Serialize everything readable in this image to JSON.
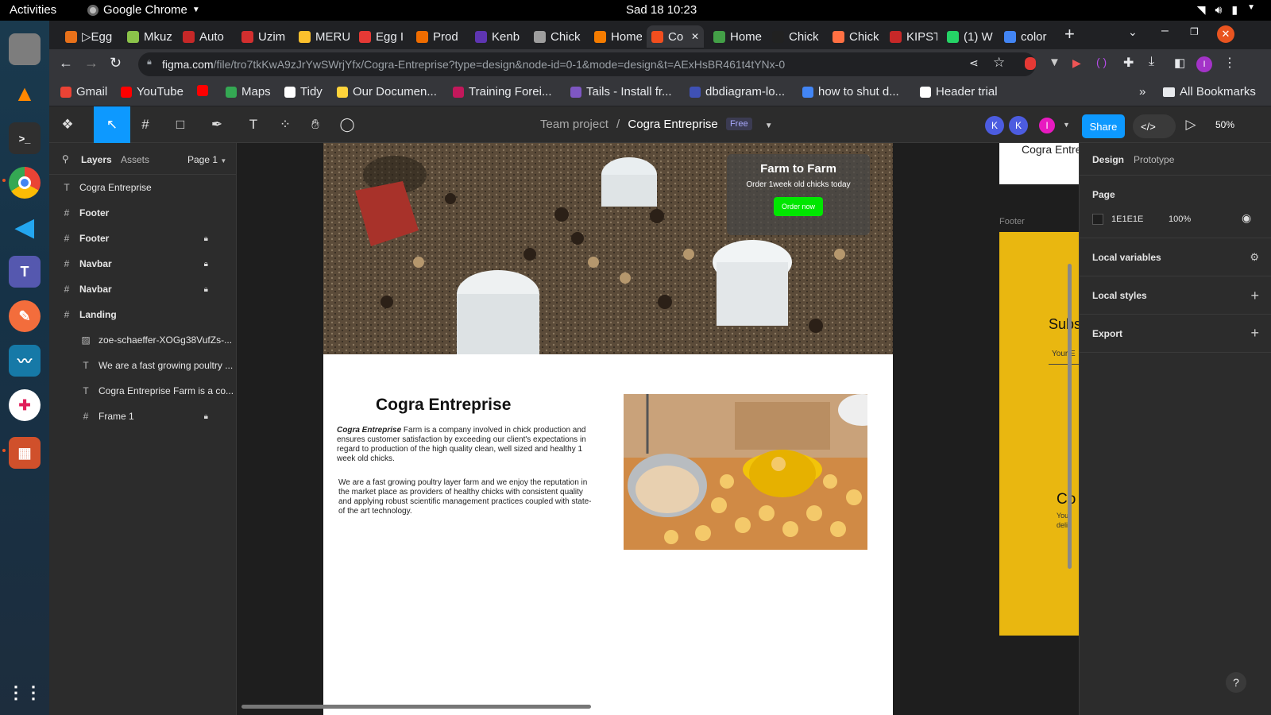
{
  "topbar": {
    "activities": "Activities",
    "app": "Google Chrome",
    "clock": "Sad 18  10:23"
  },
  "tabs": [
    {
      "label": "▷Egg",
      "color": "#e8711a"
    },
    {
      "label": "Mkuz",
      "color": "#8bc34a"
    },
    {
      "label": "Auto",
      "color": "#c62828"
    },
    {
      "label": "Uzim",
      "color": "#d32f2f"
    },
    {
      "label": "MERU",
      "color": "#fbc02d"
    },
    {
      "label": "Egg I",
      "color": "#e53935"
    },
    {
      "label": "Prod",
      "color": "#ef6c00"
    },
    {
      "label": "Kenb",
      "color": "#5e35b1"
    },
    {
      "label": "Chick",
      "color": "#9e9e9e"
    },
    {
      "label": "Home",
      "color": "#f57c00"
    },
    {
      "label": "Co",
      "color": "#f24e1e"
    },
    {
      "label": "Home",
      "color": "#43a047"
    },
    {
      "label": "Chick",
      "color": "#212121"
    },
    {
      "label": "Chick",
      "color": "#ff7043"
    },
    {
      "label": "KIPST",
      "color": "#c62828"
    },
    {
      "label": "(1) W",
      "color": "#25d366"
    },
    {
      "label": "color",
      "color": "#4285f4"
    }
  ],
  "url": {
    "host": "figma.com",
    "path": "/file/tro7tkKwA9zJrYwSWrjYfx/Cogra-Entreprise?type=design&node-id=0-1&mode=design&t=AExHsBR461t4tYNx-0"
  },
  "bookmarks": [
    {
      "label": "Gmail",
      "color": "#ea4335"
    },
    {
      "label": "YouTube",
      "color": "#ff0000"
    },
    {
      "label": "",
      "color": "#ff0000"
    },
    {
      "label": "Maps",
      "color": "#34a853"
    },
    {
      "label": "Tidy",
      "color": "#ffffff"
    },
    {
      "label": "Our Documen...",
      "color": "#ffd43b"
    },
    {
      "label": "Training Forei...",
      "color": "#c2185b"
    },
    {
      "label": "Tails - Install fr...",
      "color": "#7e57c2"
    },
    {
      "label": "dbdiagram-lo...",
      "color": "#3f51b5"
    },
    {
      "label": "how to shut d...",
      "color": "#4285f4"
    },
    {
      "label": "Header trial",
      "color": "#ffffff"
    }
  ],
  "all_bookmarks": "All Bookmarks",
  "figma": {
    "crumb_team": "Team project",
    "crumb_sep": "/",
    "crumb_file": "Cogra Entreprise",
    "plan": "Free",
    "share": "Share",
    "zoom": "50%",
    "avatars": [
      "K",
      "K",
      "I"
    ],
    "layers_tab": "Layers",
    "assets_tab": "Assets",
    "page_select": "Page 1",
    "layers": [
      {
        "name": "Cogra Entreprise",
        "icon": "T",
        "bold": false,
        "indent": 0,
        "locked": false
      },
      {
        "name": "Footer",
        "icon": "#",
        "bold": true,
        "indent": 0,
        "locked": false
      },
      {
        "name": "Footer",
        "icon": "#",
        "bold": true,
        "indent": 0,
        "locked": true
      },
      {
        "name": "Navbar",
        "icon": "#",
        "bold": true,
        "indent": 0,
        "locked": true
      },
      {
        "name": "Navbar",
        "icon": "#",
        "bold": true,
        "indent": 0,
        "locked": true
      },
      {
        "name": "Landing",
        "icon": "#",
        "bold": true,
        "indent": 0,
        "locked": false
      },
      {
        "name": "zoe-schaeffer-XOGg38VufZs-...",
        "icon": "▨",
        "bold": false,
        "indent": 1,
        "locked": false
      },
      {
        "name": "We are a fast growing poultry ...",
        "icon": "T",
        "bold": false,
        "indent": 1,
        "locked": false
      },
      {
        "name": "Cogra Entreprise Farm is a co...",
        "icon": "T",
        "bold": false,
        "indent": 1,
        "locked": false
      },
      {
        "name": "Frame 1",
        "icon": "#",
        "bold": false,
        "indent": 1,
        "locked": true
      }
    ],
    "design_tab": "Design",
    "prototype_tab": "Prototype",
    "page_label": "Page",
    "page_color": "1E1E1E",
    "page_opacity": "100%",
    "sections": [
      "Local variables",
      "Local styles",
      "Export"
    ]
  },
  "design": {
    "card_title": "Farm to Farm",
    "card_sub": "Order 1week old chicks today",
    "card_btn": "Order now",
    "title": "Cogra Entreprise",
    "p1_em": "Cogra Entreprise",
    "p1": " Farm is a company involved in chick production and ensures customer satisfaction by exceeding our client's expectations in regard to production of the high quality clean, well sized and healthy 1 week old chicks.",
    "p2": "We are a fast growing poultry layer farm and we enjoy the reputation in the market place as providers of healthy chicks with consistent quality and applying robust scientific management practices coupled with state-of the art technology.",
    "footer_label": "Footer",
    "side_title": "Cogra Entre",
    "subs": "Subs",
    "your": "Your E",
    "co": "Co",
    "your2": "Your",
    "deli": "delic"
  }
}
